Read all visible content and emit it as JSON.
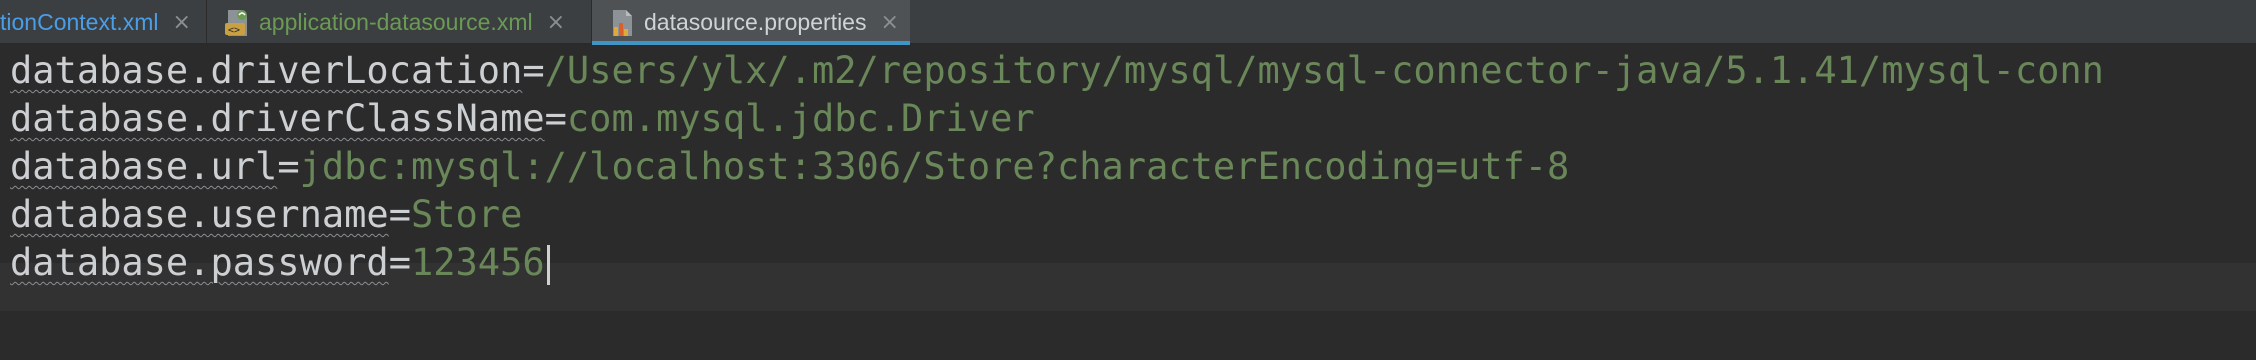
{
  "tabs": [
    {
      "label": "tionContext.xml",
      "close": "×",
      "active": false,
      "icon": "xml-file-icon"
    },
    {
      "label": "application-datasource.xml",
      "close": "×",
      "active": false,
      "icon": "spring-xml-file-icon"
    },
    {
      "label": "datasource.properties",
      "close": "×",
      "active": true,
      "icon": "properties-file-icon"
    }
  ],
  "editor": {
    "lines": [
      {
        "key": "database.driverLocation",
        "eq": "=",
        "value": "/Users/ylx/.m2/repository/mysql/mysql-connector-java/5.1.41/mysql-conn"
      },
      {
        "key": "database.driverClassName",
        "eq": "=",
        "value": "com.mysql.jdbc.Driver"
      },
      {
        "key": "database.url",
        "eq": "=",
        "value": "jdbc:mysql://localhost:3306/Store?characterEncoding=utf-8"
      },
      {
        "key": "database.username",
        "eq": "=",
        "value": "Store"
      },
      {
        "key": "database.password",
        "eq": "=",
        "value": "123456"
      }
    ]
  },
  "colors": {
    "editor_bg": "#2b2b2b",
    "tabbar_bg": "#3c3f41",
    "key": "#cdd0d3",
    "value": "#6a8759",
    "active_tab_underline": "#3f95c6"
  }
}
